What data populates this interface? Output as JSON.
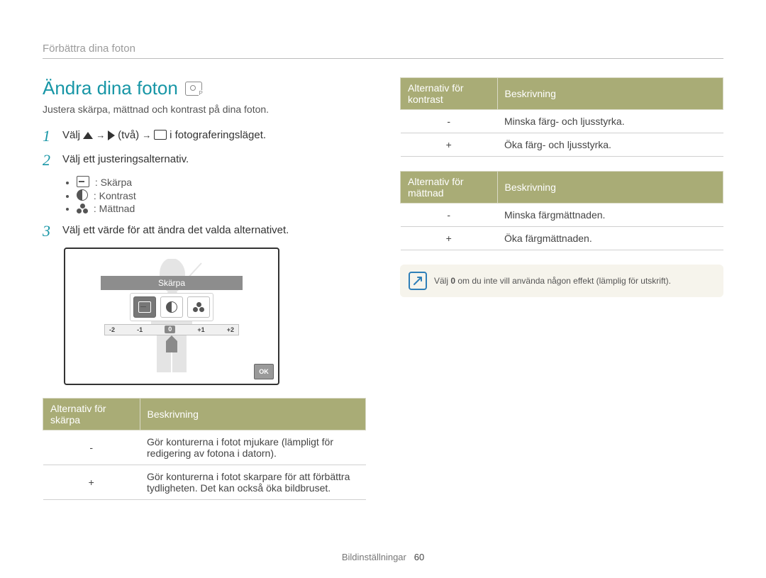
{
  "breadcrumb": "Förbättra dina foton",
  "title": "Ändra dina foton",
  "mode_badge_letter": "P",
  "intro": "Justera skärpa, mättnad och kontrast på dina foton.",
  "steps": {
    "s1_prefix": "Välj ",
    "s1_two": " (två) ",
    "s1_suffix": " i fotograferingsläget.",
    "s2": "Välj ett justeringsalternativ.",
    "s3": "Välj ett värde för att ändra det valda alternativet."
  },
  "bullets": {
    "sharp": ": Skärpa",
    "contrast": ": Kontrast",
    "satur": ": Mättnad"
  },
  "illus": {
    "label": "Skärpa",
    "scale": {
      "m2": "-2",
      "m1": "-1",
      "z": "0",
      "p1": "+1",
      "p2": "+2"
    },
    "ok": "OK"
  },
  "table_sharp": {
    "h1": "Alternativ för skärpa",
    "h2": "Beskrivning",
    "r1_sym": "-",
    "r1_desc": "Gör konturerna i fotot mjukare (lämpligt för redigering av fotona i datorn).",
    "r2_sym": "+",
    "r2_desc": "Gör konturerna i fotot skarpare för att förbättra tydligheten. Det kan också öka bildbruset."
  },
  "table_contrast": {
    "h1": "Alternativ för kontrast",
    "h2": "Beskrivning",
    "r1_sym": "-",
    "r1_desc": "Minska färg- och ljusstyrka.",
    "r2_sym": "+",
    "r2_desc": "Öka färg- och ljusstyrka."
  },
  "table_satur": {
    "h1": "Alternativ för mättnad",
    "h2": "Beskrivning",
    "r1_sym": "-",
    "r1_desc": "Minska färgmättnaden.",
    "r2_sym": "+",
    "r2_desc": "Öka färgmättnaden."
  },
  "note": {
    "pre": "Välj ",
    "bold": "0",
    "post": " om du inte vill använda någon effekt (lämplig för utskrift)."
  },
  "footer": {
    "section": "Bildinställningar",
    "page": "60"
  }
}
